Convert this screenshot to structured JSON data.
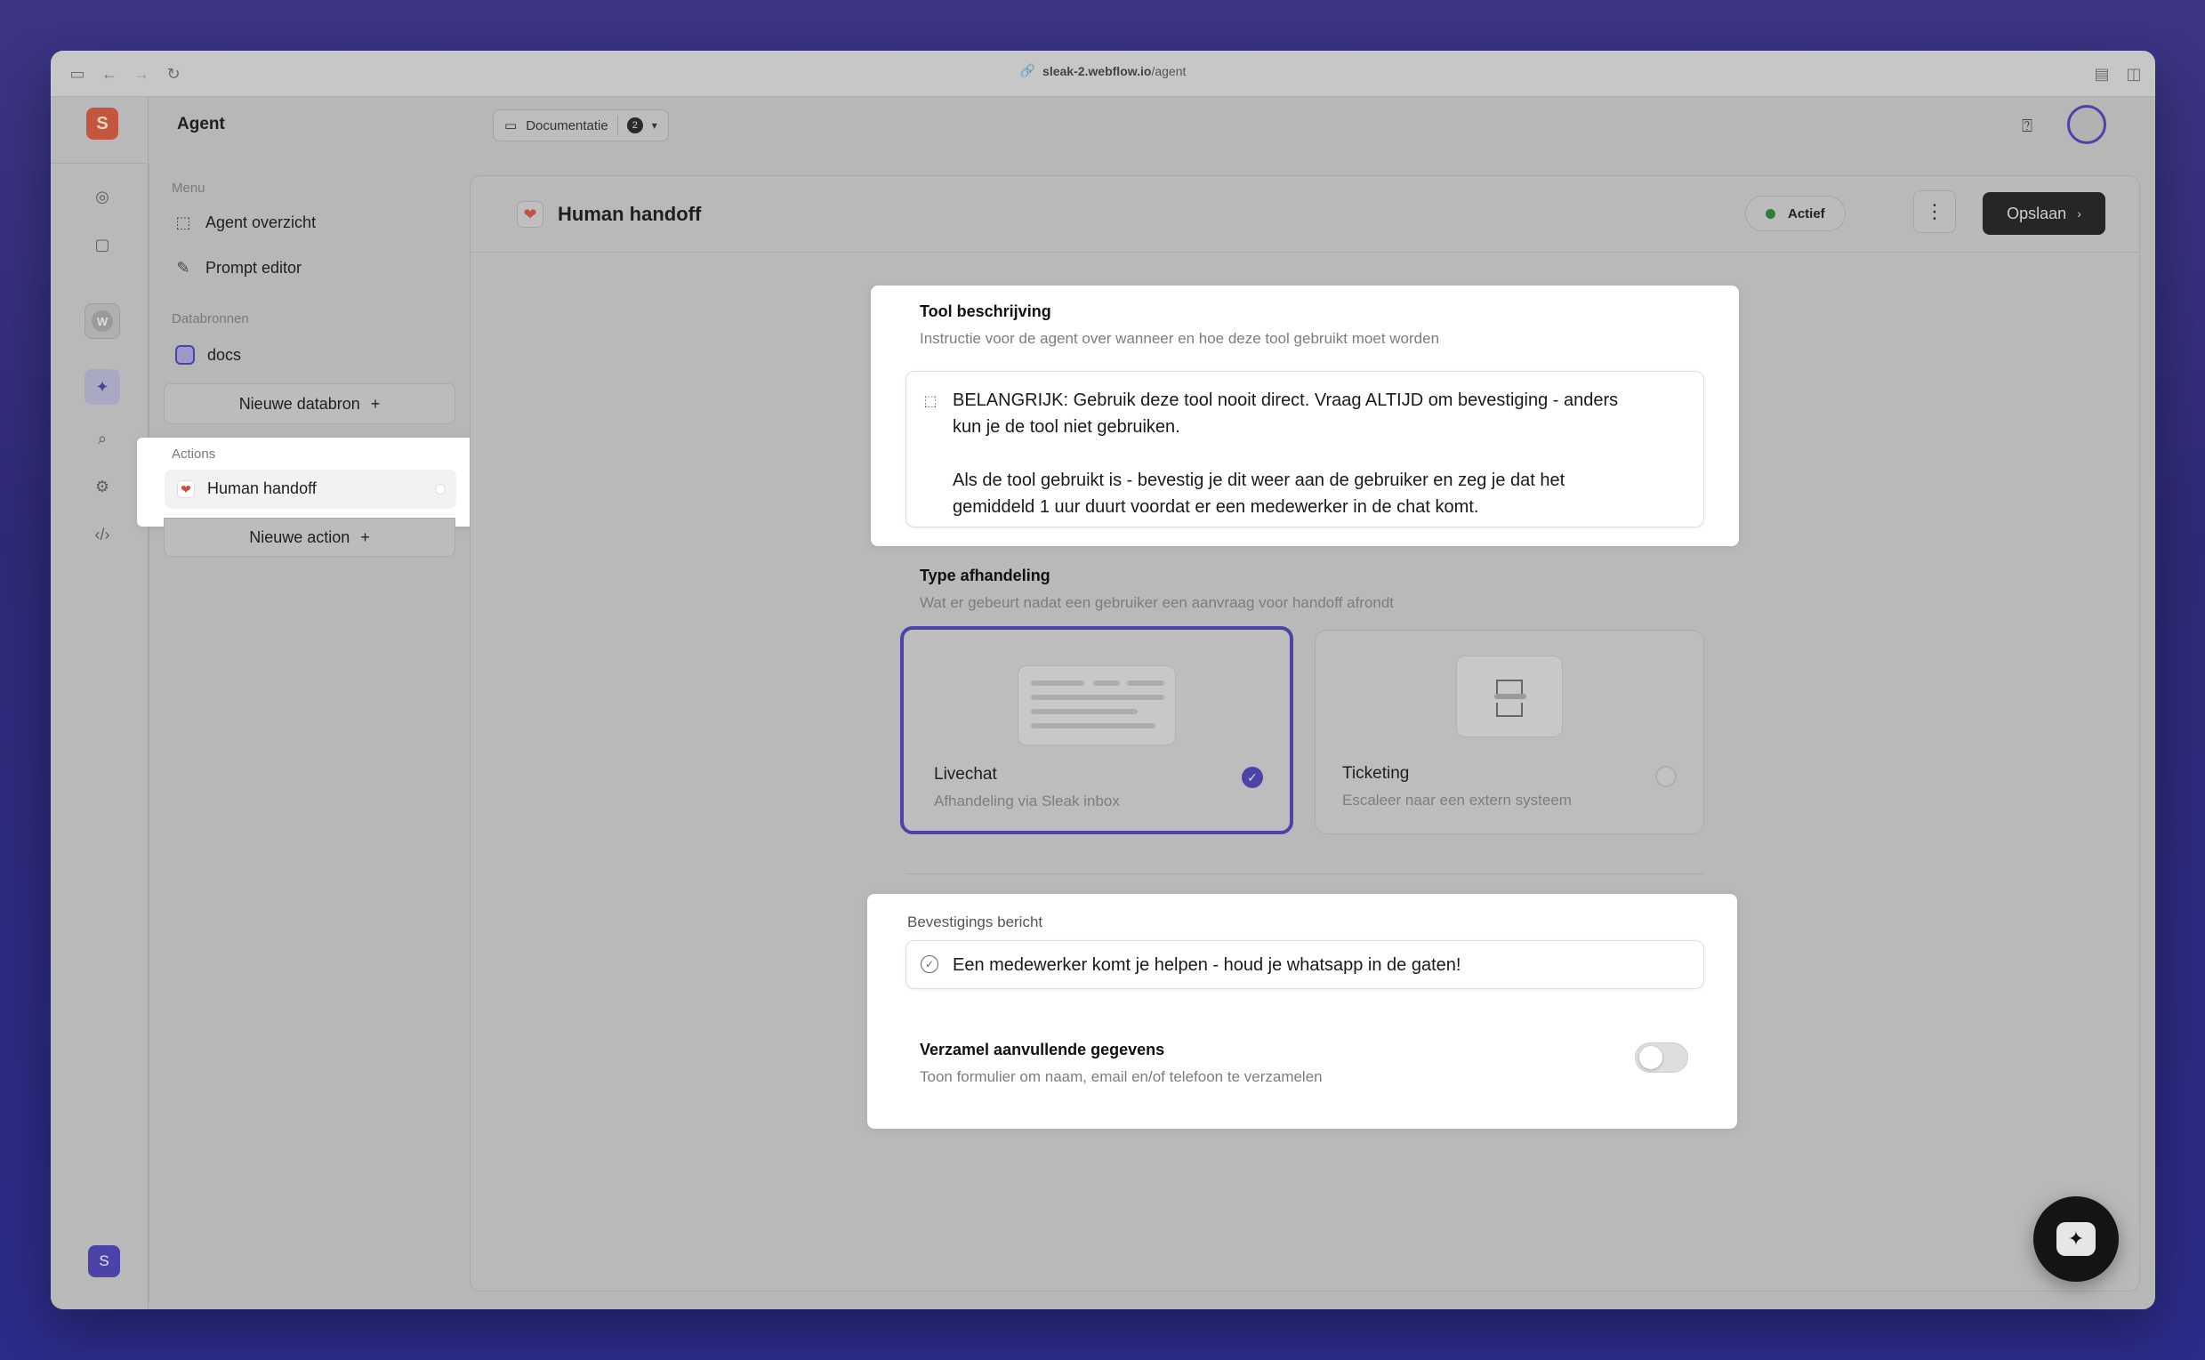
{
  "browser": {
    "url_host": "sleak-2.webflow.io",
    "url_path": "/agent"
  },
  "topbar": {
    "title": "Agent",
    "workspace_chip": "Documentatie",
    "workspace_count": "2"
  },
  "rail": {
    "logo_letter": "S",
    "workspace_letter": "W",
    "user_initial": "S"
  },
  "sidebar": {
    "menu_label": "Menu",
    "menu_items": [
      {
        "label": "Agent overzicht",
        "icon": "cursor-click-icon"
      },
      {
        "label": "Prompt editor",
        "icon": "pencil-square-icon"
      }
    ],
    "datasources_label": "Databronnen",
    "datasources": [
      {
        "label": "docs"
      }
    ],
    "new_datasource": "Nieuwe databron",
    "actions_label": "Actions",
    "actions": [
      {
        "label": "Human handoff"
      }
    ],
    "new_action": "Nieuwe action"
  },
  "main": {
    "title": "Human handoff",
    "status": "Actief",
    "save": "Opslaan",
    "tool": {
      "title": "Tool beschrijving",
      "subtitle": "Instructie voor de agent over wanneer en hoe deze tool gebruikt moet worden",
      "text": "BELANGRIJK: Gebruik deze tool nooit direct. Vraag ALTIJD om bevestiging - anders\nkun je de tool niet gebruiken.\n\nAls de tool gebruikt is - bevestig je dit weer aan de gebruiker en zeg je dat het\ngemiddeld 1 uur duurt voordat er een medewerker in de chat komt."
    },
    "handling": {
      "title": "Type afhandeling",
      "subtitle": "Wat er gebeurt nadat een gebruiker een aanvraag voor handoff afrondt",
      "options": [
        {
          "title": "Livechat",
          "subtitle": "Afhandeling via Sleak inbox",
          "selected": true
        },
        {
          "title": "Ticketing",
          "subtitle": "Escaleer naar een extern systeem",
          "selected": false
        }
      ]
    },
    "confirmation": {
      "label": "Bevestigings bericht",
      "value": "Een medewerker komt je helpen - houd je whatsapp in de gaten!"
    },
    "collect": {
      "title": "Verzamel aanvullende gegevens",
      "subtitle": "Toon formulier om naam, email en/of telefoon te verzamelen",
      "enabled": false
    }
  },
  "colors": {
    "accent": "#4c43a8",
    "brand": "#c4553f",
    "status_active": "#2f7d3a"
  }
}
